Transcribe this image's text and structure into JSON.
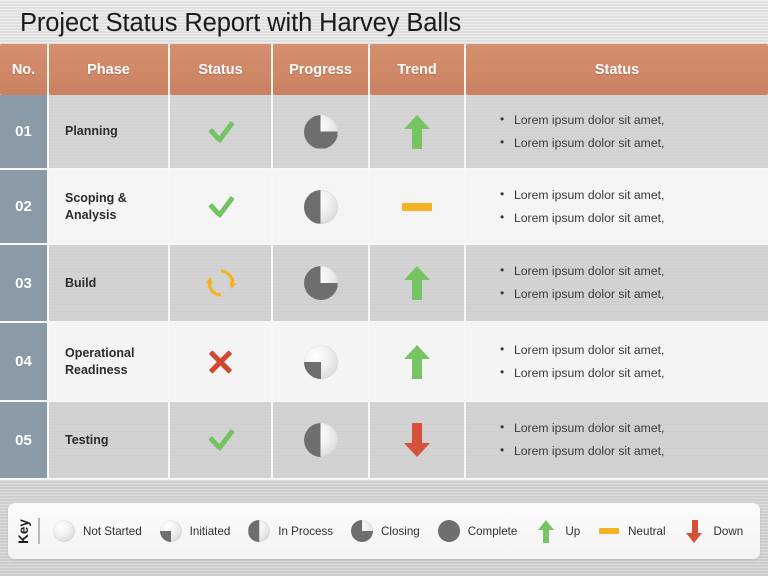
{
  "slide": {
    "title": "Project Status Report with Harvey Balls",
    "accent_header_color": "#cf8868",
    "number_column_color": "#8a9aa6",
    "green": "#77c462",
    "red": "#d6503a",
    "amber": "#f5b324",
    "harvey_fill": "#6e6e6e"
  },
  "table": {
    "headers": [
      {
        "label": "No."
      },
      {
        "label": "Phase"
      },
      {
        "label": "Status"
      },
      {
        "label": "Progress"
      },
      {
        "label": "Trend"
      },
      {
        "label": "Status"
      }
    ],
    "rows": [
      {
        "no": "01",
        "phase": "Planning",
        "status_icon": "check-icon",
        "progress": "Closing",
        "progress_pct": 75,
        "trend": "Up",
        "trend_icon": "arrow-up-icon",
        "bullets": [
          "Lorem ipsum dolor sit amet,",
          "Lorem ipsum dolor sit amet,"
        ]
      },
      {
        "no": "02",
        "phase": "Scoping  &\nAnalysis",
        "status_icon": "check-icon",
        "progress": "In Process",
        "progress_pct": 50,
        "trend": "Neutral",
        "trend_icon": "neutral-bar-icon",
        "bullets": [
          "Lorem ipsum dolor sit amet,",
          "Lorem ipsum dolor sit amet,"
        ]
      },
      {
        "no": "03",
        "phase": "Build",
        "status_icon": "refresh-icon",
        "progress": "Closing",
        "progress_pct": 75,
        "trend": "Up",
        "trend_icon": "arrow-up-icon",
        "bullets": [
          "Lorem ipsum dolor sit amet,",
          "Lorem ipsum dolor sit amet,"
        ]
      },
      {
        "no": "04",
        "phase": "Operational\nReadiness",
        "status_icon": "cross-icon",
        "progress": "Initiated",
        "progress_pct": 25,
        "trend": "Up",
        "trend_icon": "arrow-up-icon",
        "bullets": [
          "Lorem ipsum dolor sit amet,",
          "Lorem ipsum dolor sit amet,"
        ]
      },
      {
        "no": "05",
        "phase": "Testing",
        "status_icon": "check-icon",
        "progress": "In Process",
        "progress_pct": 50,
        "trend": "Down",
        "trend_icon": "arrow-down-icon",
        "bullets": [
          "Lorem ipsum dolor sit amet,",
          "Lorem ipsum dolor sit amet,"
        ]
      }
    ]
  },
  "key": {
    "label": "Key",
    "items": [
      {
        "label": "Not Started",
        "icon": "harvey-ball-0-icon",
        "pct": 0
      },
      {
        "label": "Initiated",
        "icon": "harvey-ball-25-icon",
        "pct": 25
      },
      {
        "label": "In Process",
        "icon": "harvey-ball-50-icon",
        "pct": 50
      },
      {
        "label": "Closing",
        "icon": "harvey-ball-75-icon",
        "pct": 75
      },
      {
        "label": "Complete",
        "icon": "harvey-ball-100-icon",
        "pct": 100
      },
      {
        "label": "Up",
        "icon": "arrow-up-icon"
      },
      {
        "label": "Neutral",
        "icon": "neutral-bar-icon"
      },
      {
        "label": "Down",
        "icon": "arrow-down-icon"
      }
    ]
  }
}
